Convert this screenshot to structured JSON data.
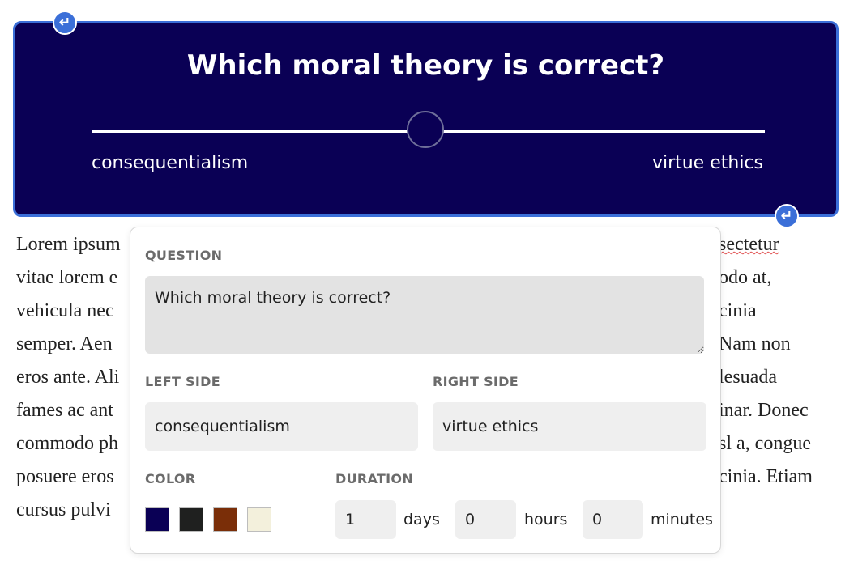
{
  "poll": {
    "question": "Which moral theory is correct?",
    "left_label": "consequentialism",
    "right_label": "virtue ethics",
    "background_color": "#0a0055",
    "border_color": "#3b6fd8"
  },
  "controls": {
    "return_icon_glyph": "↵"
  },
  "paragraph": {
    "lines": [
      {
        "left": "Lorem ipsum",
        "right": "sectetur"
      },
      {
        "left": "vitae lorem e",
        "right": "odo at,"
      },
      {
        "left": "vehicula nec",
        "right": "cinia"
      },
      {
        "left": "semper. Aen",
        "right": "Nam non"
      },
      {
        "left": "eros ante. Ali",
        "right": "lesuada"
      },
      {
        "left": "fames ac ant",
        "right": "inar. Donec"
      },
      {
        "left": "commodo ph",
        "right": "sl a, congue"
      },
      {
        "left": "posuere eros",
        "right": "cinia. Etiam"
      },
      {
        "left": "cursus pulvi",
        "right": ""
      }
    ]
  },
  "settings": {
    "question_label": "QUESTION",
    "question_value": "Which moral theory is correct?",
    "left_side_label": "LEFT SIDE",
    "left_side_value": "consequentialism",
    "right_side_label": "RIGHT SIDE",
    "right_side_value": "virtue ethics",
    "color_label": "COLOR",
    "colors": [
      "#0a0055",
      "#1f201f",
      "#7a2e08",
      "#f3f0dc"
    ],
    "duration_label": "DURATION",
    "duration": {
      "days_value": "1",
      "days_unit": "days",
      "hours_value": "0",
      "hours_unit": "hours",
      "minutes_value": "0",
      "minutes_unit": "minutes"
    }
  }
}
